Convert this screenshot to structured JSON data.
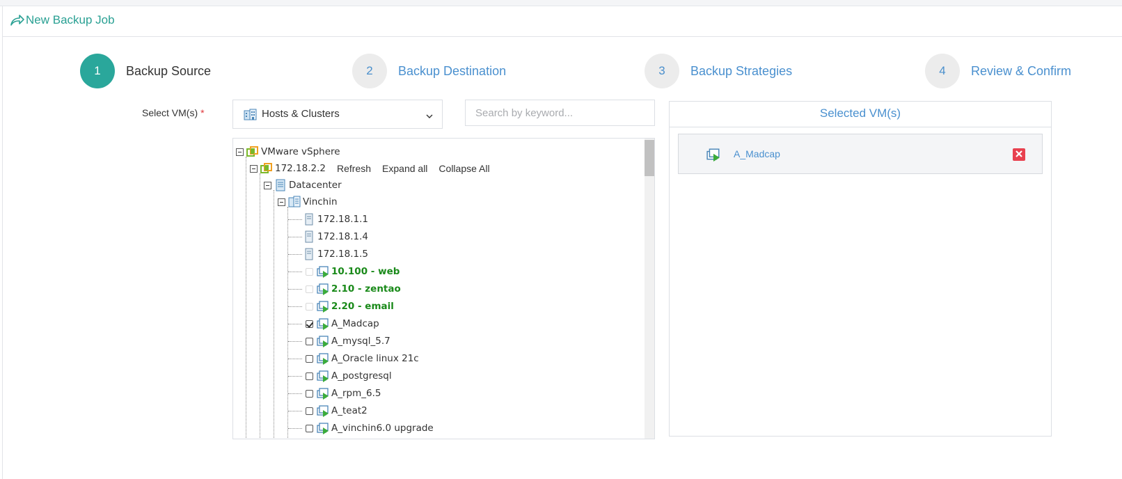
{
  "header": {
    "title": "New Backup Job",
    "icon": "share-arrow-icon"
  },
  "steps": [
    {
      "number": "1",
      "label": "Backup Source",
      "active": true
    },
    {
      "number": "2",
      "label": "Backup Destination",
      "active": false
    },
    {
      "number": "3",
      "label": "Backup Strategies",
      "active": false
    },
    {
      "number": "4",
      "label": "Review & Confirm",
      "active": false
    }
  ],
  "form": {
    "label": "Select VM(s)",
    "required_mark": "*",
    "view_select": {
      "value": "Hosts & Clusters",
      "icon": "building-icon"
    },
    "search": {
      "placeholder": "Search by keyword...",
      "value": ""
    }
  },
  "tree": {
    "root": "VMware vSphere",
    "host": "172.18.2.2",
    "toolbar": {
      "refresh": "Refresh",
      "expand_all": "Expand all",
      "collapse_all": "Collapse All"
    },
    "datacenter": "Datacenter",
    "cluster": "Vinchin",
    "hosts": [
      "172.18.1.1",
      "172.18.1.4",
      "172.18.1.5"
    ],
    "vms": [
      {
        "name": "10.100 - web",
        "style": "green-bold",
        "checked": false,
        "disabled": true
      },
      {
        "name": "2.10 - zentao",
        "style": "green-bold",
        "checked": false,
        "disabled": true
      },
      {
        "name": "2.20 - email",
        "style": "green-bold",
        "checked": false,
        "disabled": true
      },
      {
        "name": "A_Madcap",
        "style": "normal",
        "checked": true,
        "disabled": false
      },
      {
        "name": "A_mysql_5.7",
        "style": "normal",
        "checked": false,
        "disabled": false
      },
      {
        "name": "A_Oracle linux 21c",
        "style": "normal",
        "checked": false,
        "disabled": false
      },
      {
        "name": "A_postgresql",
        "style": "normal",
        "checked": false,
        "disabled": false
      },
      {
        "name": "A_rpm_6.5",
        "style": "normal",
        "checked": false,
        "disabled": false
      },
      {
        "name": "A_teat2",
        "style": "normal",
        "checked": false,
        "disabled": false
      },
      {
        "name": "A_vinchin6.0 upgrade",
        "style": "normal",
        "checked": false,
        "disabled": false
      }
    ]
  },
  "selected": {
    "title": "Selected VM(s)",
    "items": [
      {
        "name": "A_Madcap",
        "icon": "vm-running-icon"
      }
    ]
  },
  "colors": {
    "accent": "#2aa79b",
    "link": "#4a90cf",
    "vm_green": "#1a8a1a",
    "remove": "#e8414f"
  }
}
